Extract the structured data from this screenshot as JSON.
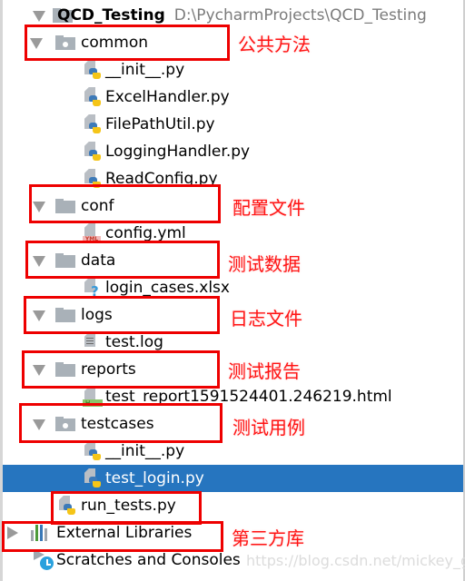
{
  "project": {
    "name": "QCD_Testing",
    "path": "D:\\PycharmProjects\\QCD_Testing"
  },
  "tree": {
    "common": {
      "label": "common",
      "files": [
        "__init__.py",
        "ExcelHandler.py",
        "FilePathUtil.py",
        "LoggingHandler.py",
        "ReadConfig.py"
      ]
    },
    "conf": {
      "label": "conf",
      "files": [
        "config.yml"
      ]
    },
    "data": {
      "label": "data",
      "files": [
        "login_cases.xlsx"
      ]
    },
    "logs": {
      "label": "logs",
      "files": [
        "test.log"
      ]
    },
    "reports": {
      "label": "reports",
      "files": [
        "test_report1591524401.246219.html"
      ]
    },
    "testcases": {
      "label": "testcases",
      "files": [
        "__init__.py",
        "test_login.py"
      ]
    },
    "run_tests": "run_tests.py",
    "external_libraries": "External Libraries",
    "scratches": "Scratches and Consoles"
  },
  "badges": {
    "yml": "YML",
    "html": "H"
  },
  "selected_item": "test_login.py",
  "annotations": {
    "common": "公共方法",
    "conf": "配置文件",
    "data": "测试数据",
    "logs": "日志文件",
    "reports": "测试报告",
    "testcases": "测试用例",
    "external_libraries": "第三方库"
  },
  "watermark": "https://blog.csdn.net/mickey_gezi",
  "colors": {
    "selection": "#2675bf",
    "annotation": "#ee0000",
    "folder": "#a9b1b8"
  }
}
